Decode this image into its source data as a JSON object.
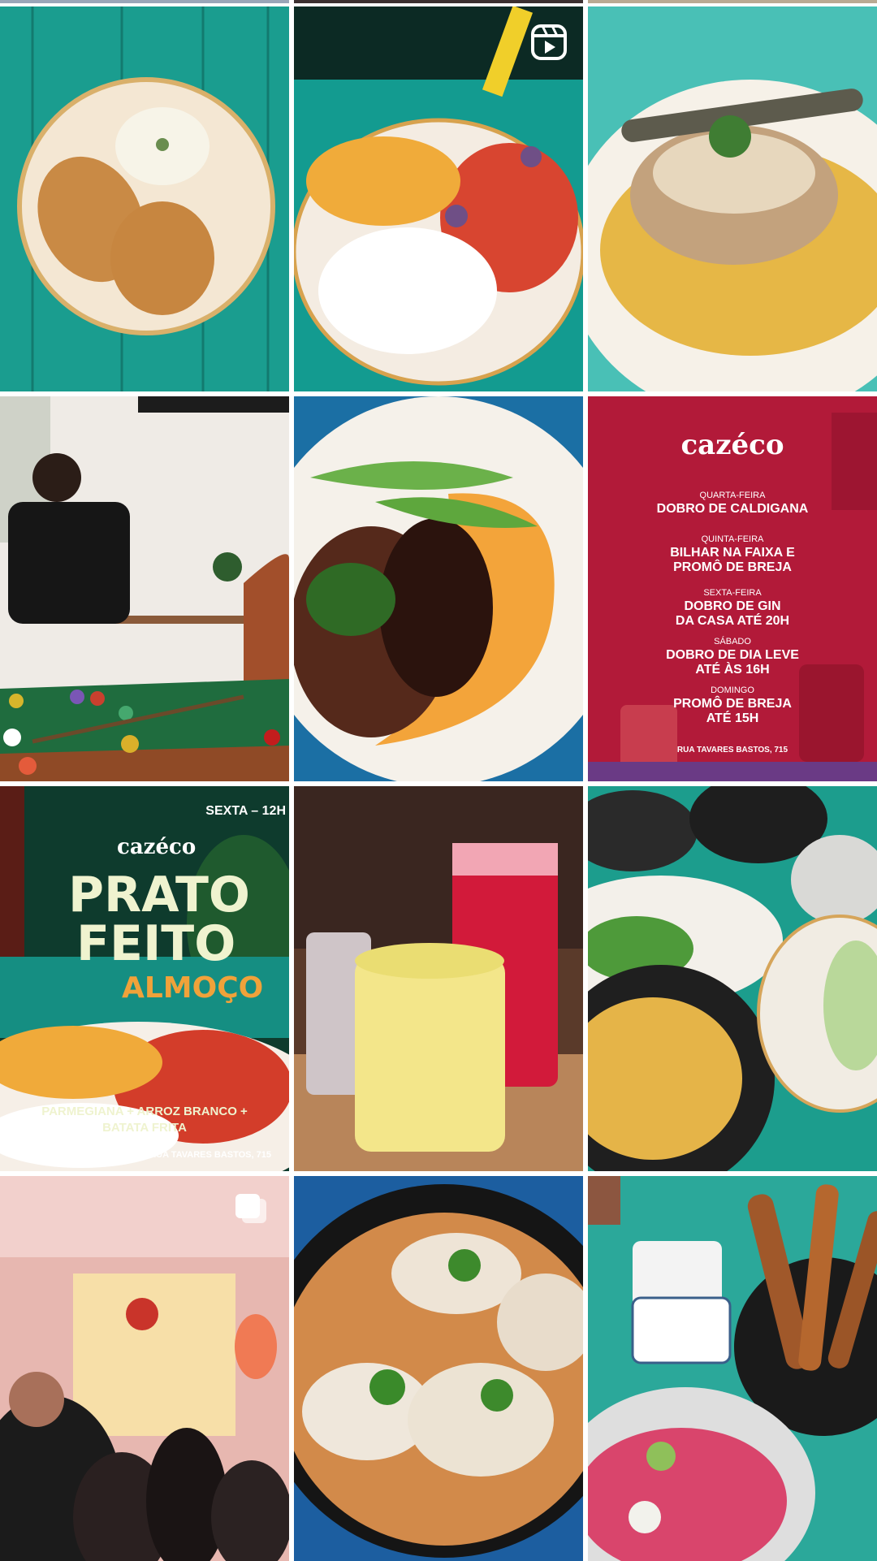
{
  "grid": {
    "tiles": [
      {
        "id": 1,
        "alt": "Schnitzel with potato salad on a teal table",
        "type": "photo"
      },
      {
        "id": 2,
        "alt": "Plate of parmigiana, fries and white rice",
        "type": "reel"
      },
      {
        "id": 3,
        "alt": "Meat on creamy polenta with green garnish",
        "type": "photo"
      },
      {
        "id": 4,
        "alt": "Man drinking next to a pool table",
        "type": "photo"
      },
      {
        "id": 5,
        "alt": "Steak with pumpkin purée and snow peas",
        "type": "photo"
      },
      {
        "id": 6,
        "alt": "Weekly promotions poster",
        "type": "photo"
      },
      {
        "id": 7,
        "alt": "Prato feito lunch poster",
        "type": "photo"
      },
      {
        "id": 8,
        "alt": "Red and yellow drinks on a wooden board",
        "type": "photo"
      },
      {
        "id": 9,
        "alt": "Bowls and plates of food on a teal table",
        "type": "photo"
      },
      {
        "id": 10,
        "alt": "Crowded restaurant interior",
        "type": "carousel"
      },
      {
        "id": 11,
        "alt": "Dumplings in broth with green onions",
        "type": "photo"
      },
      {
        "id": 12,
        "alt": "Beet hummus and fried sticks",
        "type": "photo"
      }
    ]
  },
  "promos": {
    "brand": "cazéco",
    "wed_day": "QUARTA-FEIRA",
    "wed_offer": "DOBRO DE CALDIGANA",
    "thu_day": "QUINTA-FEIRA",
    "thu_offer_1": "BILHAR NA FAIXA E",
    "thu_offer_2": "PROMÔ DE BREJA",
    "fri_day": "SEXTA-FEIRA",
    "fri_offer_1": "DOBRO DE GIN",
    "fri_offer_2": "DA CASA ATÉ 20H",
    "sat_day": "SÁBADO",
    "sat_offer_1": "DOBRO DE DIA LEVE",
    "sat_offer_2": "ATÉ ÀS 16H",
    "sun_day": "DOMINGO",
    "sun_offer_1": "PROMÔ DE BREJA",
    "sun_offer_2": "ATÉ 15H",
    "address": "RUA TAVARES BASTOS, 715"
  },
  "lunch": {
    "brand": "cazéco",
    "when": "SEXTA – 12H",
    "title_1": "PRATO",
    "title_2": "FEITO",
    "title_3": "ALMOÇO",
    "desc_1": "PARMEGIANA + ARROZ BRANCO +",
    "desc_2": "BATATA FRITA",
    "address": "RUA TAVARES BASTOS, 715"
  },
  "icons": {
    "reel": "reel-icon",
    "carousel": "carousel-icon"
  },
  "colors": {
    "teal": "#17a89a",
    "promo_red": "#b21a39",
    "lunch_green": "#0e3b2d",
    "cream_text": "#eff3cf",
    "orange_text": "#f0a23a"
  }
}
